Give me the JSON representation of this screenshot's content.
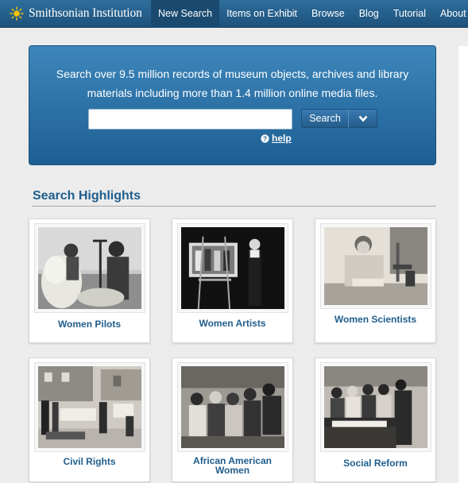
{
  "brand": {
    "name": "Smithsonian Institution",
    "logo_icon": "sun-icon"
  },
  "nav": {
    "items": [
      {
        "label": "New Search",
        "active": true
      },
      {
        "label": "Items on Exhibit",
        "active": false
      },
      {
        "label": "Browse",
        "active": false
      },
      {
        "label": "Blog",
        "active": false
      },
      {
        "label": "Tutorial",
        "active": false
      },
      {
        "label": "About",
        "active": false
      }
    ]
  },
  "search": {
    "description": "Search over 9.5 million records of museum objects, archives and library materials including more than 1.4 million online media files.",
    "input_value": "",
    "button_label": "Search",
    "dropdown_icon": "chevron-down-icon",
    "help_label": "help",
    "help_icon": "question-circle-icon"
  },
  "highlights": {
    "title": "Search Highlights",
    "cards": [
      {
        "label": "Women Pilots"
      },
      {
        "label": "Women Artists"
      },
      {
        "label": "Women Scientists"
      },
      {
        "label": "Civil Rights"
      },
      {
        "label": "African American Women"
      },
      {
        "label": "Social Reform"
      }
    ]
  },
  "colors": {
    "nav_bg": "#1d527c",
    "hero_bg": "#2a6fa3",
    "link": "#1f5d8c",
    "page_bg": "#ececec"
  }
}
